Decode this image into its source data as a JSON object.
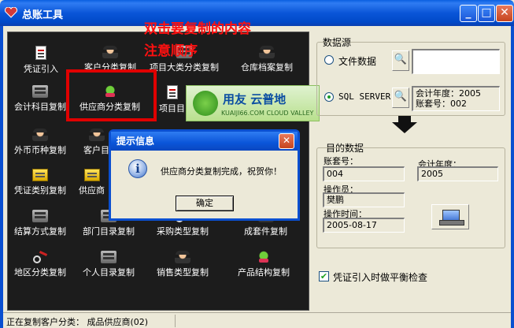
{
  "window": {
    "title": "总账工具",
    "buttons": [
      "_",
      "□",
      "✕"
    ]
  },
  "annotations": {
    "line1": "双击要复制的内容",
    "line2": "注意顺序"
  },
  "tools": [
    {
      "label": "凭证引入"
    },
    {
      "label": "客户分类复制"
    },
    {
      "label": "项目大类分类复制"
    },
    {
      "label": "仓库档案复制"
    },
    {
      "label": "会计科目复制"
    },
    {
      "label": "供应商分类复制"
    },
    {
      "label": "项目目"
    },
    {
      "label": "外币币种复制"
    },
    {
      "label": "客户目"
    },
    {
      "label": "凭证类别复制"
    },
    {
      "label": "供应商"
    },
    {
      "label": "结算方式复制"
    },
    {
      "label": "部门目录复制"
    },
    {
      "label": "采购类型复制"
    },
    {
      "label": "成套件复制"
    },
    {
      "label": "地区分类复制"
    },
    {
      "label": "个人目录复制"
    },
    {
      "label": "销售类型复制"
    },
    {
      "label": "产品结构复制"
    }
  ],
  "logo": {
    "main": "用友 云普地",
    "sub": "KUAIJI66.COM  CLOUD VALLEY"
  },
  "source": {
    "group_label": "数据源",
    "file_option": "文件数据",
    "sql_option": "SQL SERVER",
    "file_value": "",
    "sql_info": "会计年度：2005\n账套号：002"
  },
  "target": {
    "group_label": "目的数据",
    "account_label": "账套号：",
    "account_value": "004",
    "year_label": "会计年度：",
    "year_value": "2005",
    "operator_label": "操作员：",
    "operator_value": "樊鹏",
    "time_label": "操作时间：",
    "time_value": "2005-08-17"
  },
  "balance_check": {
    "label": "凭证引入时做平衡检查",
    "checked": true
  },
  "dialog": {
    "title": "提示信息",
    "message": "供应商分类复制完成，祝贺你！",
    "ok_label": "确定"
  },
  "status": {
    "text": "正在复制客户分类：  成品供应商(02)"
  },
  "colors": {
    "titlebar": "#0a55d8",
    "panel": "#1c1c1c",
    "annotation": "#ff1010"
  }
}
